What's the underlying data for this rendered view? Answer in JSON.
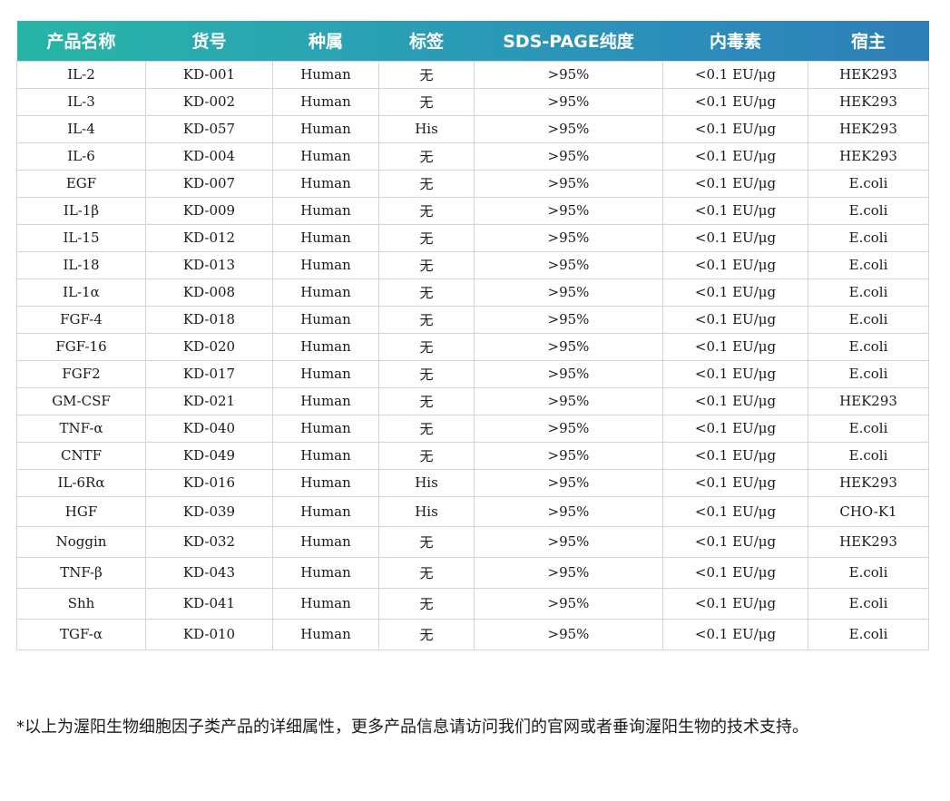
{
  "table": {
    "headers": [
      "产品名称",
      "货号",
      "种属",
      "标签",
      "SDS-PAGE纯度",
      "内毒素",
      "宿主"
    ],
    "rows": [
      [
        "IL-2",
        "KD-001",
        "Human",
        "无",
        ">95%",
        "<0.1 EU/μg",
        "HEK293"
      ],
      [
        "IL-3",
        "KD-002",
        "Human",
        "无",
        ">95%",
        "<0.1 EU/μg",
        "HEK293"
      ],
      [
        "IL-4",
        "KD-057",
        "Human",
        "His",
        ">95%",
        "<0.1 EU/μg",
        "HEK293"
      ],
      [
        "IL-6",
        "KD-004",
        "Human",
        "无",
        ">95%",
        "<0.1 EU/μg",
        "HEK293"
      ],
      [
        "EGF",
        "KD-007",
        "Human",
        "无",
        ">95%",
        "<0.1 EU/μg",
        "E.coli"
      ],
      [
        "IL-1β",
        "KD-009",
        "Human",
        "无",
        ">95%",
        "<0.1 EU/μg",
        "E.coli"
      ],
      [
        "IL-15",
        "KD-012",
        "Human",
        "无",
        ">95%",
        "<0.1 EU/μg",
        "E.coli"
      ],
      [
        "IL-18",
        "KD-013",
        "Human",
        "无",
        ">95%",
        "<0.1 EU/μg",
        "E.coli"
      ],
      [
        "IL-1α",
        "KD-008",
        "Human",
        "无",
        ">95%",
        "<0.1 EU/μg",
        "E.coli"
      ],
      [
        "FGF-4",
        "KD-018",
        "Human",
        "无",
        ">95%",
        "<0.1 EU/μg",
        "E.coli"
      ],
      [
        "FGF-16",
        "KD-020",
        "Human",
        "无",
        ">95%",
        "<0.1 EU/μg",
        "E.coli"
      ],
      [
        "FGF2",
        "KD-017",
        "Human",
        "无",
        ">95%",
        "<0.1 EU/μg",
        "E.coli"
      ],
      [
        "GM-CSF",
        "KD-021",
        "Human",
        "无",
        ">95%",
        "<0.1 EU/μg",
        "HEK293"
      ],
      [
        "TNF-α",
        "KD-040",
        "Human",
        "无",
        ">95%",
        "<0.1 EU/μg",
        "E.coli"
      ],
      [
        "CNTF",
        "KD-049",
        "Human",
        "无",
        ">95%",
        "<0.1 EU/μg",
        "E.coli"
      ],
      [
        "IL-6Rα",
        "KD-016",
        "Human",
        "His",
        ">95%",
        "<0.1 EU/μg",
        "HEK293"
      ],
      [
        "HGF",
        "KD-039",
        "Human",
        "His",
        ">95%",
        "<0.1 EU/μg",
        "CHO-K1"
      ],
      [
        "Noggin",
        "KD-032",
        "Human",
        "无",
        ">95%",
        "<0.1 EU/μg",
        "HEK293"
      ],
      [
        "TNF-β",
        "KD-043",
        "Human",
        "无",
        ">95%",
        "<0.1 EU/μg",
        "E.coli"
      ],
      [
        "Shh",
        "KD-041",
        "Human",
        "无",
        ">95%",
        "<0.1 EU/μg",
        "E.coli"
      ],
      [
        "TGF-α",
        "KD-010",
        "Human",
        "无",
        ">95%",
        "<0.1 EU/μg",
        "E.coli"
      ]
    ]
  },
  "footnote": "*以上为渥阳生物细胞因子类产品的详细属性，更多产品信息请访问我们的官网或者垂询渥阳生物的技术支持。"
}
